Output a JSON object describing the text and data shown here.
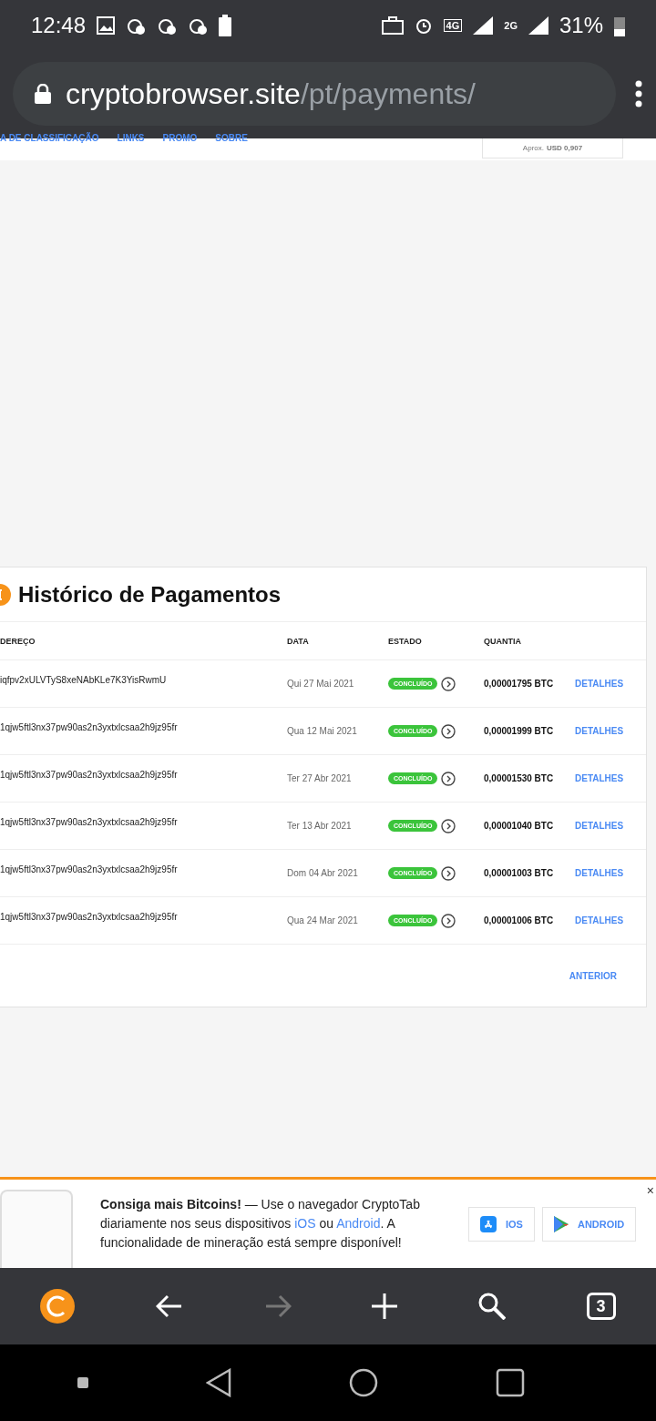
{
  "status_bar": {
    "time": "12:48",
    "network_1": "4G",
    "network_2": "2G",
    "battery": "31%"
  },
  "address_bar": {
    "domain": "cryptobrowser.site",
    "path": "/pt/payments/"
  },
  "site_nav": {
    "items": [
      "A DE CLASSIFICAÇÃO",
      "LINKS",
      "PROMO",
      "SOBRE"
    ],
    "balance_prefix": "Aprox.",
    "balance_value": "USD 0,907"
  },
  "payments": {
    "title": "Histórico de Pagamentos",
    "columns": [
      "DEREÇO",
      "DATA",
      "ESTADO",
      "QUANTIA"
    ],
    "rows": [
      {
        "address": "iqfpv2xULVTyS8xeNAbKLe7K3YisRwmU",
        "date": "Qui 27 Mai 2021",
        "status": "CONCLUÍDO",
        "amount": "0,00001795 BTC",
        "action": "DETALHES"
      },
      {
        "address": "1qjw5ftl3nx37pw90as2n3yxtxlcsaa2h9jz95fr",
        "date": "Qua 12 Mai 2021",
        "status": "CONCLUÍDO",
        "amount": "0,00001999 BTC",
        "action": "DETALHES"
      },
      {
        "address": "1qjw5ftl3nx37pw90as2n3yxtxlcsaa2h9jz95fr",
        "date": "Ter 27 Abr 2021",
        "status": "CONCLUÍDO",
        "amount": "0,00001530 BTC",
        "action": "DETALHES"
      },
      {
        "address": "1qjw5ftl3nx37pw90as2n3yxtxlcsaa2h9jz95fr",
        "date": "Ter 13 Abr 2021",
        "status": "CONCLUÍDO",
        "amount": "0,00001040 BTC",
        "action": "DETALHES"
      },
      {
        "address": "1qjw5ftl3nx37pw90as2n3yxtxlcsaa2h9jz95fr",
        "date": "Dom 04 Abr 2021",
        "status": "CONCLUÍDO",
        "amount": "0,00001003 BTC",
        "action": "DETALHES"
      },
      {
        "address": "1qjw5ftl3nx37pw90as2n3yxtxlcsaa2h9jz95fr",
        "date": "Qua 24 Mar 2021",
        "status": "CONCLUÍDO",
        "amount": "0,00001006 BTC",
        "action": "DETALHES"
      }
    ],
    "pager": "ANTERIOR"
  },
  "banner": {
    "parts": [
      {
        "kind": "bold",
        "text": "Consiga mais Bitcoins!"
      },
      {
        "kind": "text",
        "text": " — Use o navegador CryptoTab diariamente nos seus dispositivos "
      },
      {
        "kind": "link",
        "text": "iOS"
      },
      {
        "kind": "text",
        "text": " ou "
      },
      {
        "kind": "link",
        "text": "Android"
      },
      {
        "kind": "text",
        "text": ". A funcionalidade de mineração está sempre disponível!"
      }
    ],
    "buttons": [
      "IOS",
      "ANDROID"
    ],
    "close": "×"
  },
  "browser_toolbar": {
    "tab_count": "3"
  }
}
